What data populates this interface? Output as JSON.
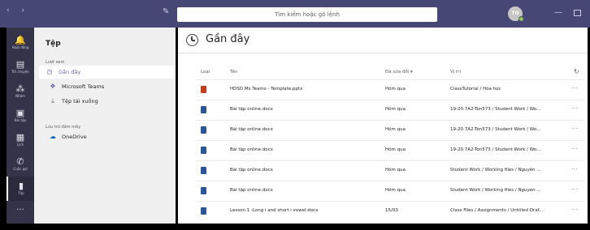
{
  "titlebar": {
    "nav_icons": "‹ ›",
    "search_placeholder": "Tìm kiếm hoặc gõ lệnh",
    "avatar_initials": "TO",
    "minimize_symbol": "—"
  },
  "rail": {
    "items": [
      {
        "label": "Hoạt động",
        "icon": "bell-icon",
        "glyph": "🔔"
      },
      {
        "label": "Trò chuyện",
        "icon": "chat-icon",
        "glyph": "▤"
      },
      {
        "label": "Nhóm",
        "icon": "teams-icon",
        "glyph": "⁂"
      },
      {
        "label": "Bài tập",
        "icon": "assignments-icon",
        "glyph": "▣"
      },
      {
        "label": "Lịch",
        "icon": "calendar-icon",
        "glyph": "▦"
      },
      {
        "label": "Cuộc gọi",
        "icon": "phone-icon",
        "glyph": "✆"
      },
      {
        "label": "Tệp",
        "icon": "files-icon",
        "glyph": "▮"
      }
    ],
    "more": "···"
  },
  "sidebar": {
    "title": "Tệp",
    "section_views": "Lượt xem",
    "section_storage": "Lưu trữ đám mây",
    "items": [
      {
        "label": "Gần đây",
        "icon": "clock-icon",
        "glyph": "◷"
      },
      {
        "label": "Microsoft Teams",
        "icon": "teams-logo-icon",
        "glyph": "❖"
      },
      {
        "label": "Tệp tải xuống",
        "icon": "download-icon",
        "glyph": "⤓"
      }
    ],
    "storage_items": [
      {
        "label": "OneDrive",
        "icon": "onedrive-icon",
        "glyph": "☁"
      }
    ]
  },
  "main": {
    "title": "Gần đây",
    "columns": {
      "type": "Loại",
      "name": "Tên",
      "modified": "Đã sửa đổi ▾",
      "location": "Vị trí"
    },
    "refresh_glyph": "↻",
    "rows": [
      {
        "type": "pptx",
        "name": "HDSD Ms Teams - Template.pptx",
        "modified": "Hôm qua",
        "location": "ClassTutorial / Hóa học"
      },
      {
        "type": "docx",
        "name": "Bài tập online.docx",
        "modified": "Hôm qua",
        "location": "19-20.7A2-Ton573 / Student Work / Wo..."
      },
      {
        "type": "docx",
        "name": "Bài tập online.docx",
        "modified": "Hôm qua",
        "location": "19-20.7A2-Ton573 / Student Work / Wo..."
      },
      {
        "type": "docx",
        "name": "Bài tập online.docx",
        "modified": "Hôm qua",
        "location": "19-20.7A2-Ton573 / Student Work / Wo..."
      },
      {
        "type": "docx",
        "name": "Bài tập online.docx",
        "modified": "Hôm qua",
        "location": "Student Work / Working files / Nguyễn ..."
      },
      {
        "type": "docx",
        "name": "Bài tập online.docx",
        "modified": "Hôm qua",
        "location": "Student Work / Working files / Nguyen ..."
      },
      {
        "type": "docx",
        "name": "Lesson 1 -Long i and short i vowel.docx",
        "modified": "15/03",
        "location": "Class Files / Assignments / Untitled Draf..."
      }
    ],
    "more_glyph": "···"
  },
  "colors": {
    "titlebar": "#464775",
    "rail": "#33344a",
    "accent": "#6264a7",
    "pptx": "#c43e1c",
    "docx": "#2b579a"
  }
}
